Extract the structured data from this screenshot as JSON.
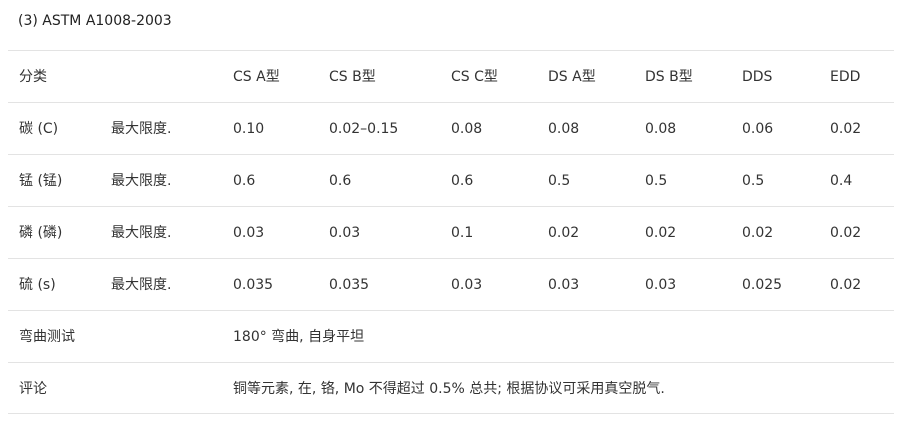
{
  "title": "(3) ASTM A1008-2003",
  "header": {
    "category": "分类",
    "columns": [
      "CS A型",
      "CS B型",
      "CS C型",
      "DS A型",
      "DS B型",
      "DDS",
      "EDD"
    ]
  },
  "rows": [
    {
      "element": "碳 (C)",
      "limit": "最大限度.",
      "values": [
        "0.10",
        "0.02–0.15",
        "0.08",
        "0.08",
        "0.08",
        "0.06",
        "0.02"
      ]
    },
    {
      "element": "锰 (锰)",
      "limit": "最大限度.",
      "values": [
        "0.6",
        "0.6",
        "0.6",
        "0.5",
        "0.5",
        "0.5",
        "0.4"
      ]
    },
    {
      "element": "磷 (磷)",
      "limit": "最大限度.",
      "values": [
        "0.03",
        "0.03",
        "0.1",
        "0.02",
        "0.02",
        "0.02",
        "0.02"
      ]
    },
    {
      "element": "硫 (s)",
      "limit": "最大限度.",
      "values": [
        "0.035",
        "0.035",
        "0.03",
        "0.03",
        "0.03",
        "0.025",
        "0.02"
      ]
    }
  ],
  "bend_test": {
    "label": "弯曲测试",
    "value": "180° 弯曲, 自身平坦"
  },
  "comment": {
    "label": "评论",
    "value": "铜等元素, 在, 铬, Mo 不得超过 0.5% 总共; 根据协议可采用真空脱气."
  }
}
